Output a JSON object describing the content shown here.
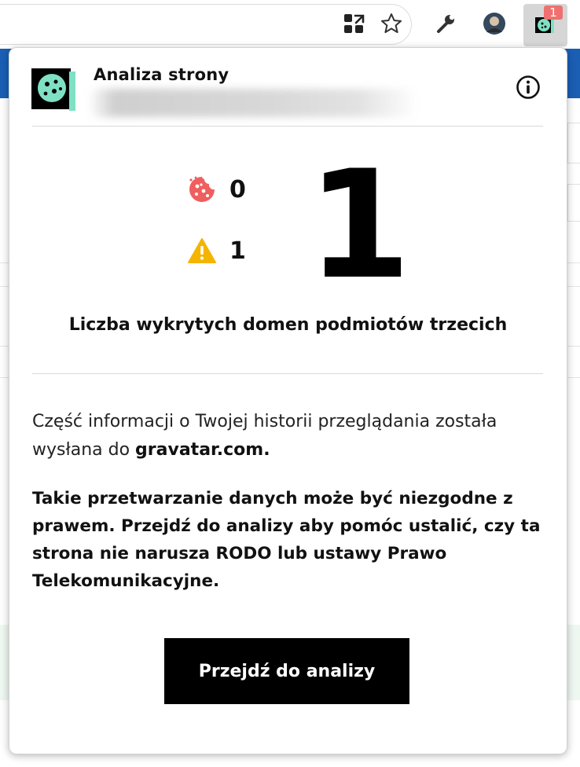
{
  "toolbar": {
    "icons": [
      "apps-grid-icon",
      "bookmark-star-icon",
      "wrench-icon",
      "profile-avatar",
      "extension-cookie-icon"
    ],
    "extension_badge": "1"
  },
  "popup": {
    "title": "Analiza strony",
    "stats": {
      "cookies_count": "0",
      "warnings_count": "1"
    },
    "third_party_domains_count": "1",
    "third_party_caption": "Liczba wykrytych domen podmiotów trzecich",
    "info_text_prefix": "Część informacji o Twojej historii przeglądania została wysłana do ",
    "info_domain": "gravatar.com",
    "info_text_suffix": ".",
    "warning_text": "Takie przetwarzanie danych może być niezgodne z prawem. Przejdź do analizy aby pomóc ustalić, czy ta strona nie narusza RODO lub ustawy Prawo Telekomunikacyjne.",
    "cta_label": "Przejdź do analizy"
  },
  "colors": {
    "cookie_accent": "#f05e5e",
    "warning_accent": "#f5b400",
    "logo_mint": "#7fe0c4",
    "button_bg": "#000000"
  }
}
